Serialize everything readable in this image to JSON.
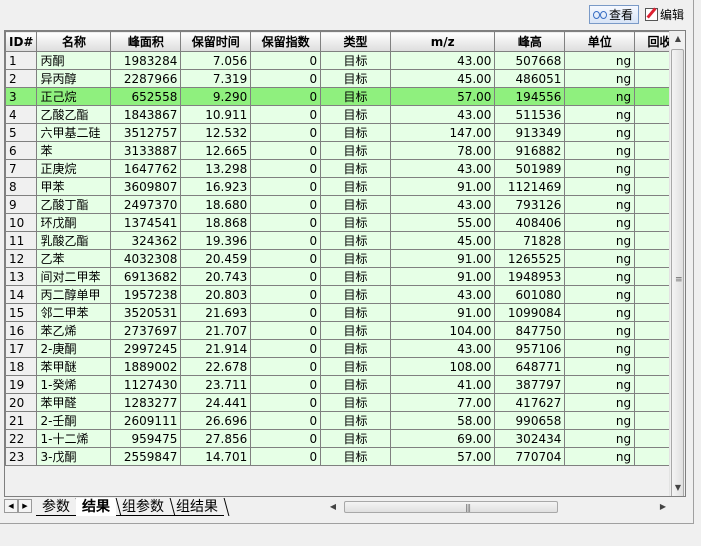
{
  "toolbar": {
    "view_label": "查看",
    "edit_label": "编辑"
  },
  "table": {
    "columns": [
      "ID#",
      "名称",
      "峰面积",
      "保留时间",
      "保留指数",
      "类型",
      "m/z",
      "峰高",
      "单位",
      "回收"
    ],
    "selected_row": 3,
    "rows": [
      [
        "1",
        "丙酮",
        "1983284",
        "7.056",
        "0",
        "目标",
        "43.00",
        "507668",
        "ng"
      ],
      [
        "2",
        "异丙醇",
        "2287966",
        "7.319",
        "0",
        "目标",
        "45.00",
        "486051",
        "ng"
      ],
      [
        "3",
        "正己烷",
        "652558",
        "9.290",
        "0",
        "目标",
        "57.00",
        "194556",
        "ng"
      ],
      [
        "4",
        "乙酸乙酯",
        "1843867",
        "10.911",
        "0",
        "目标",
        "43.00",
        "511536",
        "ng"
      ],
      [
        "5",
        "六甲基二硅",
        "3512757",
        "12.532",
        "0",
        "目标",
        "147.00",
        "913349",
        "ng"
      ],
      [
        "6",
        "苯",
        "3133887",
        "12.665",
        "0",
        "目标",
        "78.00",
        "916882",
        "ng"
      ],
      [
        "7",
        "正庚烷",
        "1647762",
        "13.298",
        "0",
        "目标",
        "43.00",
        "501989",
        "ng"
      ],
      [
        "8",
        "甲苯",
        "3609807",
        "16.923",
        "0",
        "目标",
        "91.00",
        "1121469",
        "ng"
      ],
      [
        "9",
        "乙酸丁酯",
        "2497370",
        "18.680",
        "0",
        "目标",
        "43.00",
        "793126",
        "ng"
      ],
      [
        "10",
        "环戊酮",
        "1374541",
        "18.868",
        "0",
        "目标",
        "55.00",
        "408406",
        "ng"
      ],
      [
        "11",
        "乳酸乙酯",
        "324362",
        "19.396",
        "0",
        "目标",
        "45.00",
        "71828",
        "ng"
      ],
      [
        "12",
        "乙苯",
        "4032308",
        "20.459",
        "0",
        "目标",
        "91.00",
        "1265525",
        "ng"
      ],
      [
        "13",
        "间对二甲苯",
        "6913682",
        "20.743",
        "0",
        "目标",
        "91.00",
        "1948953",
        "ng"
      ],
      [
        "14",
        "丙二醇单甲",
        "1957238",
        "20.803",
        "0",
        "目标",
        "43.00",
        "601080",
        "ng"
      ],
      [
        "15",
        "邻二甲苯",
        "3520531",
        "21.693",
        "0",
        "目标",
        "91.00",
        "1099084",
        "ng"
      ],
      [
        "16",
        "苯乙烯",
        "2737697",
        "21.707",
        "0",
        "目标",
        "104.00",
        "847750",
        "ng"
      ],
      [
        "17",
        "2-庚酮",
        "2997245",
        "21.914",
        "0",
        "目标",
        "43.00",
        "957106",
        "ng"
      ],
      [
        "18",
        "苯甲醚",
        "1889002",
        "22.678",
        "0",
        "目标",
        "108.00",
        "648771",
        "ng"
      ],
      [
        "19",
        "1-癸烯",
        "1127430",
        "23.711",
        "0",
        "目标",
        "41.00",
        "387797",
        "ng"
      ],
      [
        "20",
        "苯甲醛",
        "1283277",
        "24.441",
        "0",
        "目标",
        "77.00",
        "417627",
        "ng"
      ],
      [
        "21",
        "2-壬酮",
        "2609111",
        "26.696",
        "0",
        "目标",
        "58.00",
        "990658",
        "ng"
      ],
      [
        "22",
        "1-十二烯",
        "959475",
        "27.856",
        "0",
        "目标",
        "69.00",
        "302434",
        "ng"
      ],
      [
        "23",
        "3-戊酮",
        "2559847",
        "14.701",
        "0",
        "目标",
        "57.00",
        "770704",
        "ng"
      ]
    ]
  },
  "tabs": [
    {
      "label": "参数",
      "active": false
    },
    {
      "label": "结果",
      "active": true
    },
    {
      "label": "组参数",
      "active": false
    },
    {
      "label": "组结果",
      "active": false
    }
  ],
  "colors": {
    "row_bg": "#e6ffe6",
    "selected_row_bg": "#8ff07e"
  }
}
